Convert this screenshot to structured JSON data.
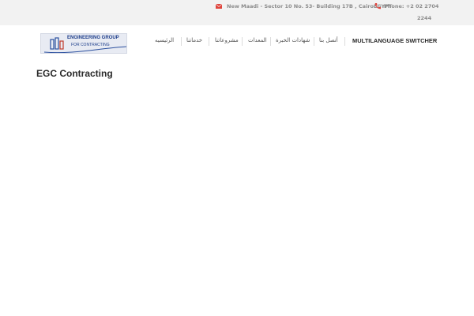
{
  "topbar": {
    "address": "New Maadi - Sector 10 No. 53- Building 17B , CairoEGYPT",
    "phone_line1": "Phone: +2 02 2704",
    "phone_line2": "2244",
    "icon_address": "envelope-icon",
    "icon_phone": "phone-icon",
    "icon_color": "#e0443c"
  },
  "logo": {
    "line1": "ENGINEERING GROUP",
    "line2": "FOR CONTRACTING"
  },
  "nav": {
    "home": "الرئيسيه",
    "services": "خدماتنا",
    "projects": "مشروعاتنا",
    "equipment": "المعدات",
    "certificates": "شهادات الخبرة",
    "contact": "أتصل بنا",
    "switcher": "MULTILANGUAGE SWITCHER"
  },
  "page": {
    "title": "EGC Contracting"
  }
}
